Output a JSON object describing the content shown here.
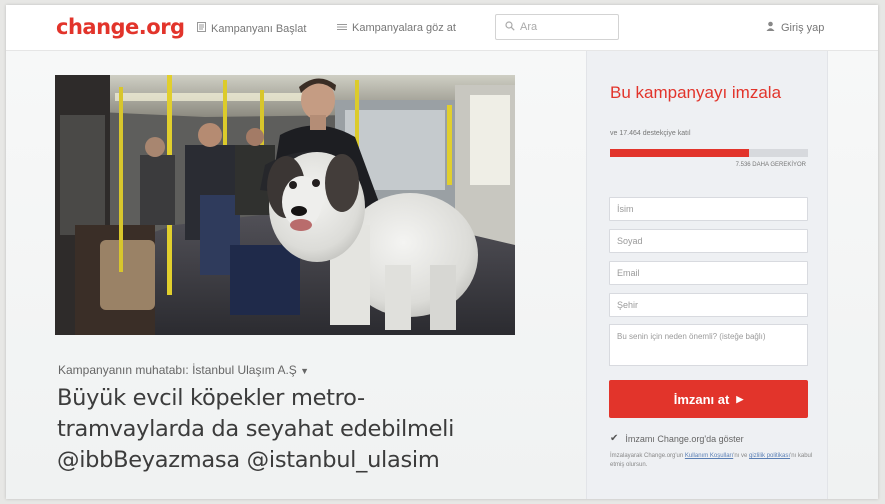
{
  "header": {
    "logo": "change.org",
    "nav_start": "Kampanyanı Başlat",
    "nav_browse": "Kampanyalara göz at",
    "search_placeholder": "Ara",
    "login": "Giriş yap"
  },
  "campaign": {
    "target": "Kampanyanın muhatabı: İstanbul Ulaşım A.Ş",
    "title_line1": "Büyük evcil köpekler metro-",
    "title_line2": "tramvaylarda da seyahat edebilmeli",
    "title_line3": "@ibbBeyazmasa @istanbul_ulasim"
  },
  "sign_panel": {
    "title": "Bu kampanyayı imzala",
    "progress_text": "ve 17.464 destekçiye katıl",
    "progress_needed": "7.536 DAHA GEREKİYOR",
    "progress_fraction": 0.7,
    "name_placeholder": "İsim",
    "surname_placeholder": "Soyad",
    "email_placeholder": "Email",
    "city_placeholder": "Şehir",
    "reason_placeholder": "Bu senin için neden önemli? (isteğe bağlı)",
    "sign_button": "İmzanı at",
    "show_signature_label": "İmzamı Change.org'da göster",
    "terms_prefix": "İmzalayarak Change.org'un",
    "terms_link1": "Kullanım Koşulları",
    "terms_middle": "'nı ve",
    "terms_link2": "gizlilik politikası",
    "terms_suffix": "'nı kabul etmiş olursun."
  },
  "colors": {
    "brand_red": "#e2342b"
  }
}
